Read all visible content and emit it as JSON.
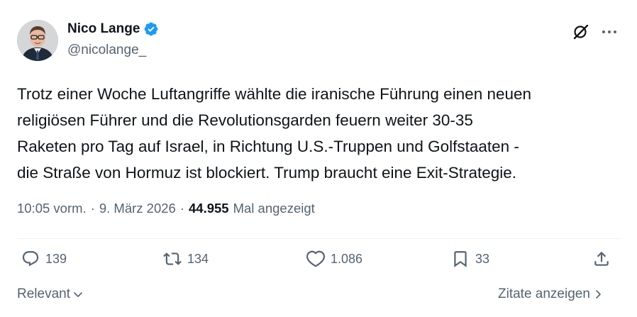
{
  "author": {
    "name": "Nico Lange",
    "handle": "@nicolange_"
  },
  "tweet": {
    "text": "Trotz einer Woche Luftangriffe wählte die iranische Führung einen neuen\nreligiösen Führer und die Revolutionsgarden feuern weiter 30-35\nRaketen pro Tag auf Israel, in Richtung U.S.-Truppen und Golfstaaten -\ndie Straße von Hormuz ist blockiert. Trump braucht eine Exit-Strategie.",
    "time": "10:05 vorm.",
    "date": "9. März 2026",
    "views": "44.955",
    "views_label": "Mal angezeigt",
    "separator": "·"
  },
  "actions": {
    "replies": "139",
    "reposts": "134",
    "likes": "1.086",
    "bookmarks": "33"
  },
  "footer": {
    "sort_label": "Relevant",
    "quotes_label": "Zitate anzeigen"
  },
  "colors": {
    "text": "#0f1419",
    "secondary": "#536471",
    "verified": "#1d9bf0",
    "divider": "#eff3f4"
  }
}
